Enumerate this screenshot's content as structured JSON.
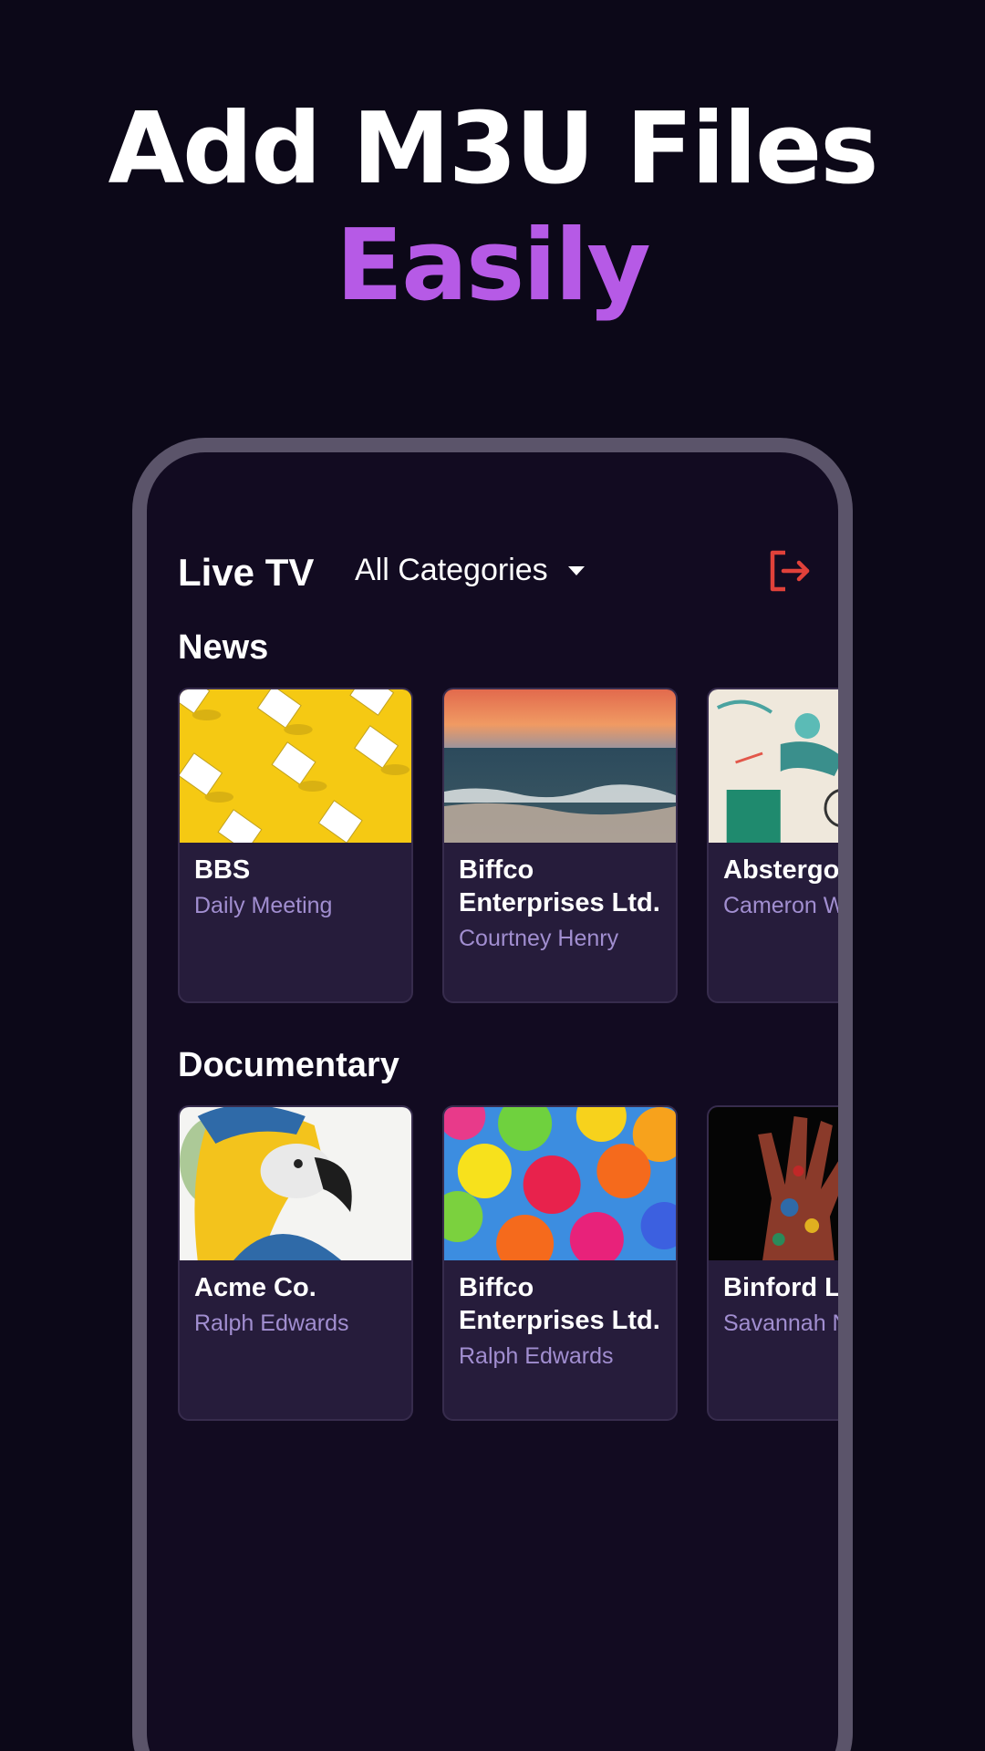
{
  "headline": {
    "line1": "Add M3U Files",
    "line2": "Easily"
  },
  "app": {
    "title": "Live TV",
    "category": "All Categories",
    "logout_icon": "logout-icon",
    "accent": "#e0413a"
  },
  "sections": [
    {
      "title": "News",
      "cards": [
        {
          "title": "BBS",
          "subtitle": "Daily Meeting"
        },
        {
          "title": "Biffco Enterprises Ltd.",
          "subtitle": "Courtney Henry"
        },
        {
          "title": "Abstergo",
          "subtitle": "Cameron Williamson"
        }
      ]
    },
    {
      "title": "Documentary",
      "cards": [
        {
          "title": "Acme Co.",
          "subtitle": "Ralph Edwards"
        },
        {
          "title": "Biffco Enterprises Ltd.",
          "subtitle": "Ralph Edwards"
        },
        {
          "title": "Binford Ltd.",
          "subtitle": "Savannah Nguyen"
        }
      ]
    }
  ],
  "colors": {
    "background": "#0c0818",
    "headline_accent": "#b65ae6",
    "card_bg": "#261c3b",
    "subtitle": "#a18ed0"
  }
}
